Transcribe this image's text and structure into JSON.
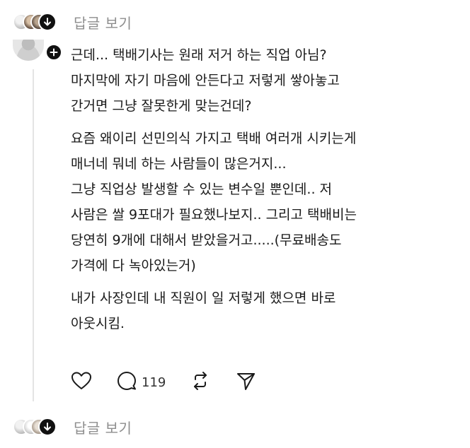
{
  "thread": {
    "view_replies_top": "답글 보기",
    "view_replies_bottom": "답글 보기"
  },
  "comment": {
    "paragraphs": [
      [
        "근데... 택배기사는 원래 저거 하는 직업 아님?",
        "마지막에 자기 마음에 안든다고 저렇게 쌓아놓고",
        "간거면 그냥 잘못한게 맞는건데?"
      ],
      [
        "요즘 왜이리 선민의식 가지고 택배 여러개 시키는게",
        "매너네 뭐네 하는 사람들이 많은거지...",
        "그냥 직업상 발생할 수 있는 변수일 뿐인데.. 저",
        "사람은 쌀 9포대가 필요했나보지.. 그리고 택배비는",
        "당연히 9개에 대해서 받았을거고.....(무료배송도",
        "가격에 다 녹아있는거)"
      ],
      [
        "내가 사장인데 내 직원이 일 저렇게 했으면 바로",
        "아웃시킴."
      ]
    ],
    "actions": {
      "like_icon": "heart-icon",
      "comment_icon": "comment-bubble-icon",
      "comment_count": "119",
      "repost_icon": "repost-icon",
      "share_icon": "send-icon"
    }
  }
}
